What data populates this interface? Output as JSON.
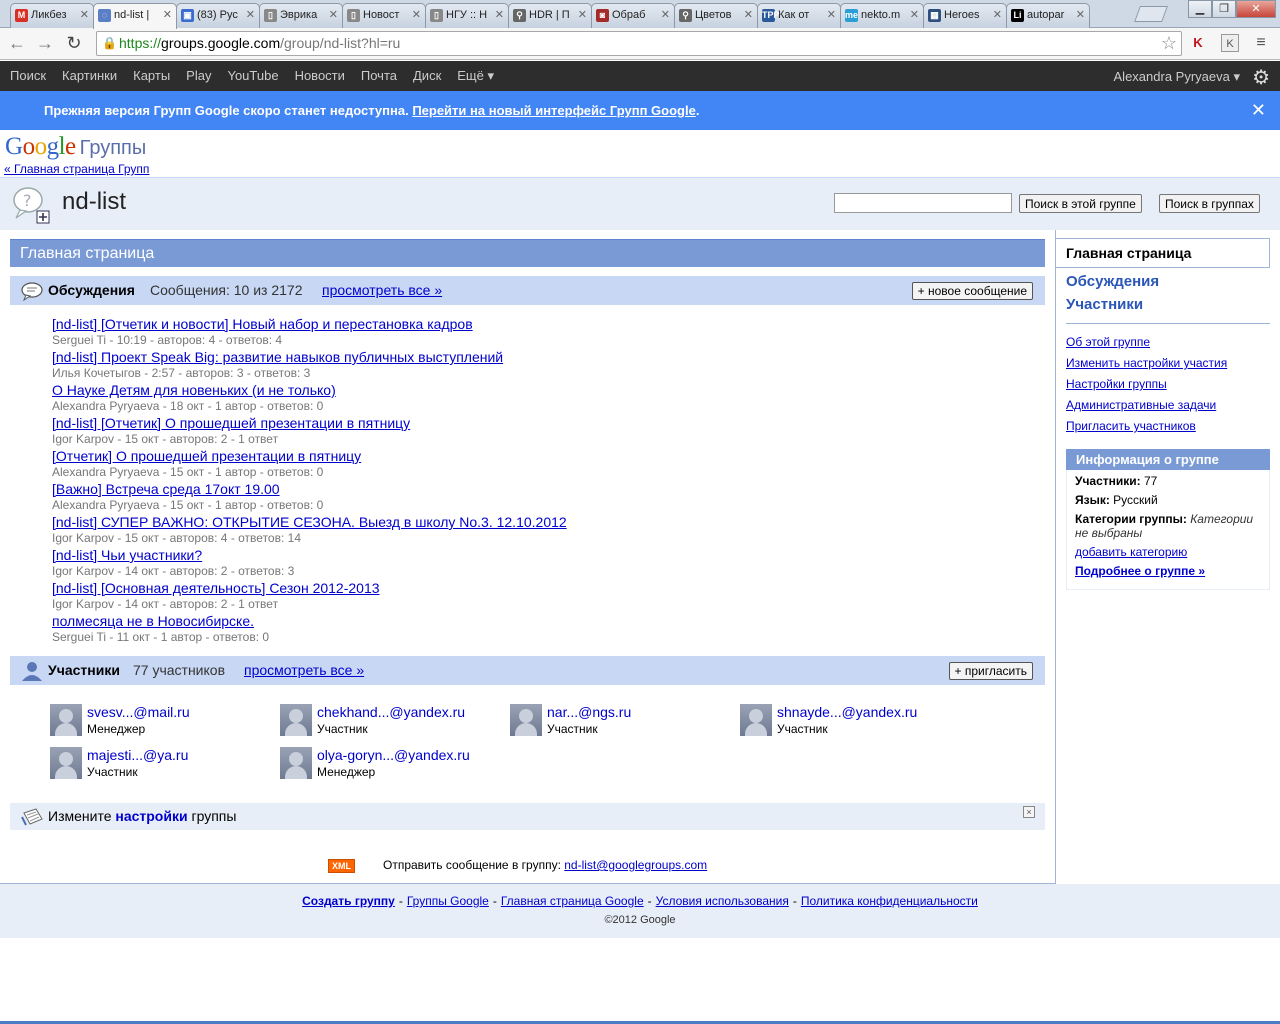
{
  "browser": {
    "tabs": [
      {
        "title": "Ликбез",
        "fav": "M",
        "color": "#d93025"
      },
      {
        "title": "nd-list |",
        "fav": "◌",
        "color": "#5b7fc7"
      },
      {
        "title": "(83) Рус",
        "fav": "▣",
        "color": "#3b6ccf"
      },
      {
        "title": "Эврика",
        "fav": "▯",
        "color": "#888888"
      },
      {
        "title": "Новост",
        "fav": "▯",
        "color": "#888888"
      },
      {
        "title": "НГУ :: Н",
        "fav": "▯",
        "color": "#888888"
      },
      {
        "title": "HDR | П",
        "fav": "⚲",
        "color": "#666666"
      },
      {
        "title": "Обраб",
        "fav": "◙",
        "color": "#a52a2a"
      },
      {
        "title": "Цветов",
        "fav": "⚲",
        "color": "#666666"
      },
      {
        "title": "Как от",
        "fav": "TPP",
        "color": "#2b5a9b"
      },
      {
        "title": "nekto.m",
        "fav": "me",
        "color": "#2a9fd6"
      },
      {
        "title": "Heroes",
        "fav": "▦",
        "color": "#2f4f7f"
      },
      {
        "title": "autopar",
        "fav": "Li",
        "color": "#000000"
      }
    ],
    "url_https": "https://",
    "url_host": "groups.google.com",
    "url_path": "/group/nd-list?hl=ru"
  },
  "gbar": {
    "items": [
      "Поиск",
      "Картинки",
      "Карты",
      "Play",
      "YouTube",
      "Новости",
      "Почта",
      "Диск",
      "Ещё ▾"
    ],
    "user": "Alexandra Pyryaeva ▾"
  },
  "notice": {
    "text": "Прежняя версия Групп Google скоро станет недоступна. ",
    "link": "Перейти на новый интерфейс Групп Google",
    "dot": "."
  },
  "header": {
    "logo_groups": "Группы",
    "back_link": "« Главная страница Групп",
    "group_name": "nd-list",
    "btn_search_group": "Поиск в этой группе",
    "btn_search_groups": "Поиск в группах"
  },
  "main": {
    "section_title": "Главная страница",
    "discussions": {
      "label": "Обсуждения",
      "count": "Сообщения: 10 из 2172",
      "view_all": "просмотреть все »",
      "new_btn": "+ новое сообщение",
      "threads": [
        {
          "title": "[nd-list] [Отчетик и новости] Новый набор и перестановка кадров",
          "meta": "Serguei Ti - 10:19 - авторов: 4 - ответов: 4"
        },
        {
          "title": "[nd-list] Проект Speak Big: развитие навыков публичных выступлений",
          "meta": "Илья Кочетыгов - 2:57 - авторов: 3 - ответов: 3"
        },
        {
          "title": "О Науке Детям для новеньких (и не только)",
          "meta": "Alexandra Pyryaeva - 18 окт - 1 автор - ответов: 0"
        },
        {
          "title": "[nd-list] [Отчетик] О прошедшей презентации в пятницу",
          "meta": "Igor Karpov - 15 окт - авторов: 2 - 1 ответ"
        },
        {
          "title": "[Отчетик] О прошедшей презентации в пятницу",
          "meta": "Alexandra Pyryaeva - 15 окт - 1 автор - ответов: 0"
        },
        {
          "title": "[Важно] Встреча среда 17окт 19.00",
          "meta": "Alexandra Pyryaeva - 15 окт - 1 автор - ответов: 0"
        },
        {
          "title": "[nd-list] СУПЕР ВАЖНО: ОТКРЫТИЕ СЕЗОНА. Выезд в школу No.3. 12.10.2012",
          "meta": "Igor Karpov - 15 окт - авторов: 4 - ответов: 14"
        },
        {
          "title": "[nd-list] Чьи участники?",
          "meta": "Igor Karpov - 14 окт - авторов: 2 - ответов: 3"
        },
        {
          "title": "[nd-list] [Основная деятельность] Сезон 2012-2013",
          "meta": "Igor Karpov - 14 окт - авторов: 2 - 1 ответ"
        },
        {
          "title": "полмесяца не в Новосибирске.",
          "meta": "Serguei Ti - 11 окт - 1 автор - ответов: 0"
        }
      ]
    },
    "members": {
      "label": "Участники",
      "count": "77 участников",
      "view_all": "просмотреть все »",
      "invite_btn": "+ пригласить",
      "list": [
        {
          "email": "svesv...@mail.ru",
          "role": "Менеджер"
        },
        {
          "email": "chekhand...@yandex.ru",
          "role": "Участник"
        },
        {
          "email": "nar...@ngs.ru",
          "role": "Участник"
        },
        {
          "email": "shnayde...@yandex.ru",
          "role": "Участник"
        },
        {
          "email": "majesti...@ya.ru",
          "role": "Участник"
        },
        {
          "email": "olya-goryn...@yandex.ru",
          "role": "Менеджер"
        }
      ]
    },
    "settings_box": {
      "pre": "Измените ",
      "bold": "настройки",
      "post": " группы",
      "close": "×"
    },
    "send": {
      "xml": "XML",
      "text": "Отправить сообщение в группу: ",
      "email": "nd-list@googlegroups.com"
    }
  },
  "sidebar": {
    "active_tab": "Главная страница",
    "nav": [
      "Обсуждения",
      "Участники"
    ],
    "links": [
      "Об этой группе",
      "Изменить настройки участия",
      "Настройки группы",
      "Административные задачи",
      "Пригласить участников"
    ],
    "info": {
      "title": "Информация о группе",
      "members_label": "Участники:",
      "members_value": " 77",
      "lang_label": "Язык:",
      "lang_value": " Русский",
      "cat_label": "Категории группы:",
      "cat_value": " Категории не выбраны",
      "add_cat": "добавить категорию",
      "more": "Подробнее о группе »"
    }
  },
  "footer": {
    "links": [
      "Создать группу",
      "Группы Google",
      "Главная страница Google",
      "Условия использования",
      "Политика конфиденциальности"
    ],
    "copyright": "©2012 Google"
  }
}
